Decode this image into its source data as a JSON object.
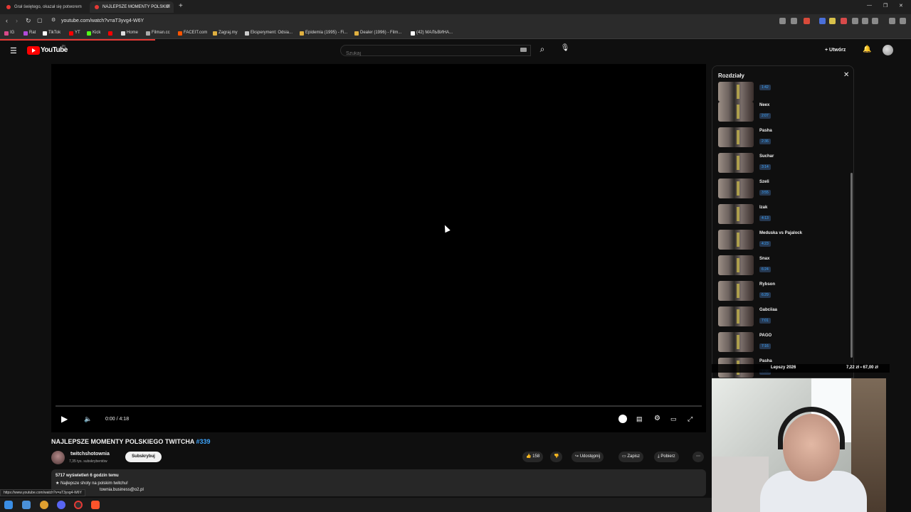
{
  "browser": {
    "tabs": [
      {
        "title": "Grał świętego, okazał się potworem"
      },
      {
        "title": "NAJLEPSZE MOMENTY POLSKIE"
      }
    ],
    "url": "youtube.com/watch?v=aT3yvg4-W6Y",
    "bookmarks": [
      "IG",
      "Rat",
      "TikTok",
      "YT",
      "Kick",
      "Home",
      "Filman.cc",
      "FACEIT.com",
      "Zagraj.my",
      "Eksperyment: Odsia...",
      "Epidemia (1995) - Fi...",
      "Dealer (1996) - Film...",
      "(42) МАЛЬВИНА..."
    ],
    "status_url": "https://www.youtube.com/watch?v=aT3yvg4-W6Y"
  },
  "youtube": {
    "logo_text": "YouTube",
    "logo_country": "PL",
    "search_placeholder": "Szukaj",
    "create_label": "Utwórz"
  },
  "player": {
    "time": "0:00 / 4:18"
  },
  "video": {
    "title": "NAJLEPSZE MOMENTY POLSKIEGO TWITCHA",
    "tag": "#339",
    "channel": "twitchshotownia",
    "subscribers": "7,35 tys. subskrybentów",
    "subscribe_label": "Subskrybuj",
    "likes": "158",
    "share_label": "Udostępnij",
    "save_label": "Zapisz",
    "download_label": "Pobierz",
    "views_line": "5717 wyświetleń  6 godzin temu",
    "desc_line1": "★ Najlepsze shoty na polskim twitchu!",
    "desc_line2": "townia.business@o2.pl"
  },
  "chapters": {
    "title": "Rozdziały",
    "items": [
      {
        "name": "",
        "time": "1:42"
      },
      {
        "name": "Neex",
        "time": "2:07"
      },
      {
        "name": "Pasha",
        "time": "2:36"
      },
      {
        "name": "Suchar",
        "time": "3:14"
      },
      {
        "name": "Szeli",
        "time": "3:55"
      },
      {
        "name": "Izak",
        "time": "4:13"
      },
      {
        "name": "Meduska vs Pajalock",
        "time": "4:23"
      },
      {
        "name": "Snax",
        "time": "6:24"
      },
      {
        "name": "Rybson",
        "time": "6:29"
      },
      {
        "name": "Gabciiaa",
        "time": "7:01"
      },
      {
        "name": "PAGO",
        "time": "7:16"
      },
      {
        "name": "Pasha",
        "time": "7:38"
      }
    ]
  },
  "overlay": {
    "left_text": "Lepszy 2026",
    "right_text": "7,22 zł ▪ 67,00 zł"
  },
  "colors": {
    "accent_red": "#ff0000",
    "link_blue": "#3ea6ff",
    "background": "#0f0f0f"
  }
}
